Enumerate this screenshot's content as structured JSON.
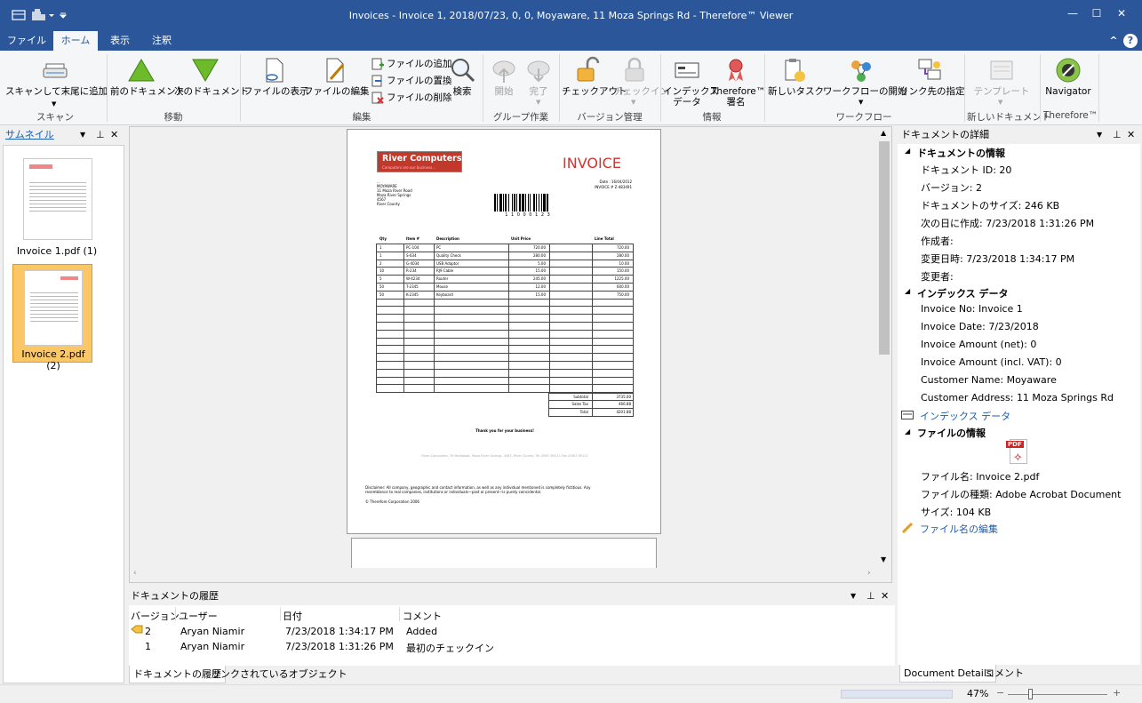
{
  "window": {
    "title": "Invoices - Invoice 1, 2018/07/23, 0, 0, Moyaware, 11 Moza Springs Rd - Therefore™ Viewer",
    "controls": {
      "minimize": "—",
      "maximize": "☐",
      "close": "✕"
    }
  },
  "tabs": [
    {
      "label": "ファイル"
    },
    {
      "label": "ホーム"
    },
    {
      "label": "表示"
    },
    {
      "label": "注釈"
    }
  ],
  "ribbon": {
    "scan": {
      "btn": "スキャンして末尾に追加",
      "group": "スキャン"
    },
    "move": {
      "prev": "前のドキュメント",
      "next": "次のドキュメント",
      "group": "移動"
    },
    "edit": {
      "view": "ファイルの表示",
      "edit": "ファイルの編集",
      "add": "ファイルの追加",
      "replace": "ファイルの置換",
      "delete": "ファイルの削除",
      "search": "検索",
      "group": "編集"
    },
    "group_work": {
      "start": "開始",
      "done": "完了",
      "group": "グループ作業"
    },
    "version": {
      "checkout": "チェックアウト",
      "checkin": "チェックイン",
      "group": "バージョン管理"
    },
    "info": {
      "index1": "インデックス",
      "index2": "データ",
      "sign1": "Therefore™",
      "sign2": "署名",
      "group": "情報"
    },
    "workflow": {
      "task": "新しいタスク",
      "start": "ワークフローの開始",
      "link": "リンク先の指定",
      "group": "ワークフロー"
    },
    "newdoc": {
      "template": "テンプレート",
      "group": "新しいドキュメント"
    },
    "therefore": {
      "navigator": "Navigator",
      "group": "Therefore™"
    },
    "collapse": "^",
    "help": "?"
  },
  "thumbnails": {
    "header": "サムネイル",
    "items": [
      {
        "label": "Invoice 1.pdf (1)"
      },
      {
        "label": "Invoice 2.pdf (2)"
      }
    ]
  },
  "invoice": {
    "company": "River Computers",
    "tagline": "Computers are our business...",
    "heading": "INVOICE",
    "date_line": "Date : 16/04/2012",
    "number_line": "INVOICE # Z-483491",
    "address": [
      "...",
      "MOYAWARE",
      "11 Moza River Road",
      "Moza River Springs",
      "4567",
      "River County"
    ],
    "barcode_text": "1 1 0 0 0 1 2 3",
    "columns": [
      "Qty",
      "Item #",
      "Description",
      "Unit Price",
      "Line Total"
    ],
    "rows": [
      [
        "1",
        "PC-104",
        "PC",
        "720.00",
        "720.00"
      ],
      [
        "1",
        "S-634",
        "Quality Check",
        "280.00",
        "280.00"
      ],
      [
        "2",
        "G-4034",
        "USB Adaptor",
        "5.00",
        "10.00"
      ],
      [
        "10",
        "R-234",
        "RJ9 Cable",
        "15.00",
        "150.00"
      ],
      [
        "5",
        "W-4234",
        "Router",
        "245.00",
        "1225.00"
      ],
      [
        "50",
        "T-2345",
        "Mouse",
        "12.00",
        "600.00"
      ],
      [
        "50",
        "K-2345",
        "Keyboard",
        "15.00",
        "750.00"
      ]
    ],
    "subtotal_label": "Subtotal",
    "subtotal": "3735.00",
    "tax_label": "Sales Tax",
    "tax": "466.88",
    "total_label": "Total",
    "total": "4201.88",
    "thanks": "Thank you for your business!",
    "footer_addr": "River Computers, 39 Mallaboot, Moza River Springs, 4567, River County, Tel (0567 89111  Fax (0567 89112",
    "disclaimer1": "Disclaimer: All company, geographic and contact information, as well as any individual mentioned is completely fictitious. Any",
    "disclaimer2": "resemblance to real companies, institutions or individuals—past or present—is purely coincidental.",
    "copyright": "© Therefore Corporation 2006"
  },
  "history": {
    "header": "ドキュメントの履歴",
    "columns": [
      "バージョン",
      "ユーザー",
      "日付",
      "コメント"
    ],
    "rows": [
      {
        "version": "2",
        "user": "Aryan Niamir",
        "date": "7/23/2018 1:34:17 PM",
        "comment": "Added"
      },
      {
        "version": "1",
        "user": "Aryan Niamir",
        "date": "7/23/2018 1:31:26 PM",
        "comment": "最初のチェックイン"
      }
    ],
    "tabs": [
      "ドキュメントの履歴",
      "リンクされているオブジェクト"
    ]
  },
  "details": {
    "header": "ドキュメントの詳細",
    "doc_info_title": "ドキュメントの情報",
    "doc_info": [
      "ドキュメント ID: 20",
      "バージョン: 2",
      "ドキュメントのサイズ: 246 KB",
      "次の日に作成: 7/23/2018 1:31:26 PM",
      "作成者:",
      "変更日時: 7/23/2018 1:34:17 PM",
      "変更者:"
    ],
    "index_title": "インデックス データ",
    "index": [
      "Invoice No:  Invoice 1",
      "Invoice Date:  7/23/2018",
      "Invoice Amount (net):  0",
      "Invoice Amount (incl. VAT):  0",
      "Customer Name:  Moyaware",
      "Customer Address:  11 Moza Springs Rd"
    ],
    "index_link": "インデックス データ",
    "file_info_title": "ファイルの情報",
    "pdf_label": "PDF",
    "file_info": [
      "ファイル名: Invoice 2.pdf",
      "ファイルの種類: Adobe Acrobat Document",
      "サイズ: 104 KB"
    ],
    "rename_link": "ファイル名の編集",
    "tabs": [
      "Document Details",
      "コメント"
    ]
  },
  "status": {
    "zoom": "47%",
    "minus": "−",
    "plus": "+"
  }
}
